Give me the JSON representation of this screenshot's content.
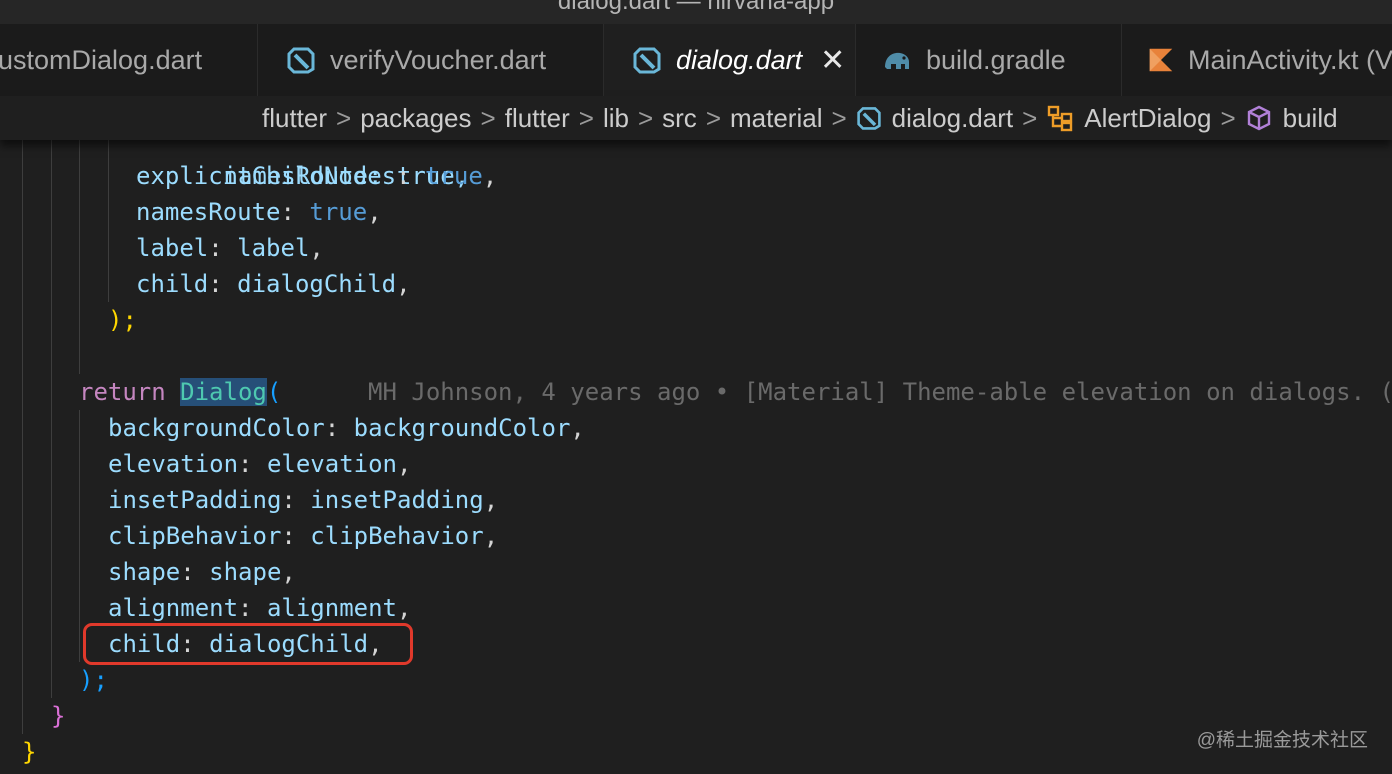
{
  "window": {
    "title": "dialog.dart — nirvana-app"
  },
  "tabs": [
    {
      "label": "ustomDialog.dart",
      "icon": "dart-icon"
    },
    {
      "label": "verifyVoucher.dart",
      "icon": "dart-icon"
    },
    {
      "label": "dialog.dart",
      "icon": "dart-icon",
      "active": true,
      "close": "✕"
    },
    {
      "label": "build.gradle",
      "icon": "gradle-elephant-icon"
    },
    {
      "label": "MainActivity.kt (V",
      "icon": "kotlin-icon"
    }
  ],
  "breadcrumb": {
    "items": [
      "flutter",
      "packages",
      "flutter",
      "lib",
      "src",
      "material",
      "dialog.dart",
      "AlertDialog",
      "build"
    ],
    "separator": ">"
  },
  "code": {
    "partial_line": "      namesRoute: true,",
    "lines": [
      {
        "indent": "      ",
        "name": "explicitChildNodes",
        "value": "true",
        "value_kind": "bool"
      },
      {
        "indent": "      ",
        "name": "namesRoute",
        "value": "true",
        "value_kind": "bool"
      },
      {
        "indent": "      ",
        "name": "label",
        "value": "label",
        "value_kind": "var"
      },
      {
        "indent": "      ",
        "name": "child",
        "value": "dialogChild",
        "value_kind": "var"
      }
    ],
    "close_paren_1": ");",
    "return_keyword": "return",
    "return_class": "Dialog",
    "return_paren": "(",
    "blame": "MH Johnson, 4 years ago • [Material] Theme-able elevation on dialogs. (",
    "dialog_props": [
      {
        "name": "backgroundColor",
        "value": "backgroundColor"
      },
      {
        "name": "elevation",
        "value": "elevation"
      },
      {
        "name": "insetPadding",
        "value": "insetPadding"
      },
      {
        "name": "clipBehavior",
        "value": "clipBehavior"
      },
      {
        "name": "shape",
        "value": "shape"
      },
      {
        "name": "alignment",
        "value": "alignment"
      },
      {
        "name": "child",
        "value": "dialogChild"
      }
    ],
    "close_paren_2": ");",
    "close_brace_1": "}",
    "close_brace_2": "}"
  },
  "watermark": "@稀土掘金技术社区",
  "colors": {
    "highlight_box": "#e0392b",
    "keyword": "#c586c0",
    "class": "#4ec9b0",
    "property": "#9cdcfe",
    "boolean": "#569cd6"
  }
}
